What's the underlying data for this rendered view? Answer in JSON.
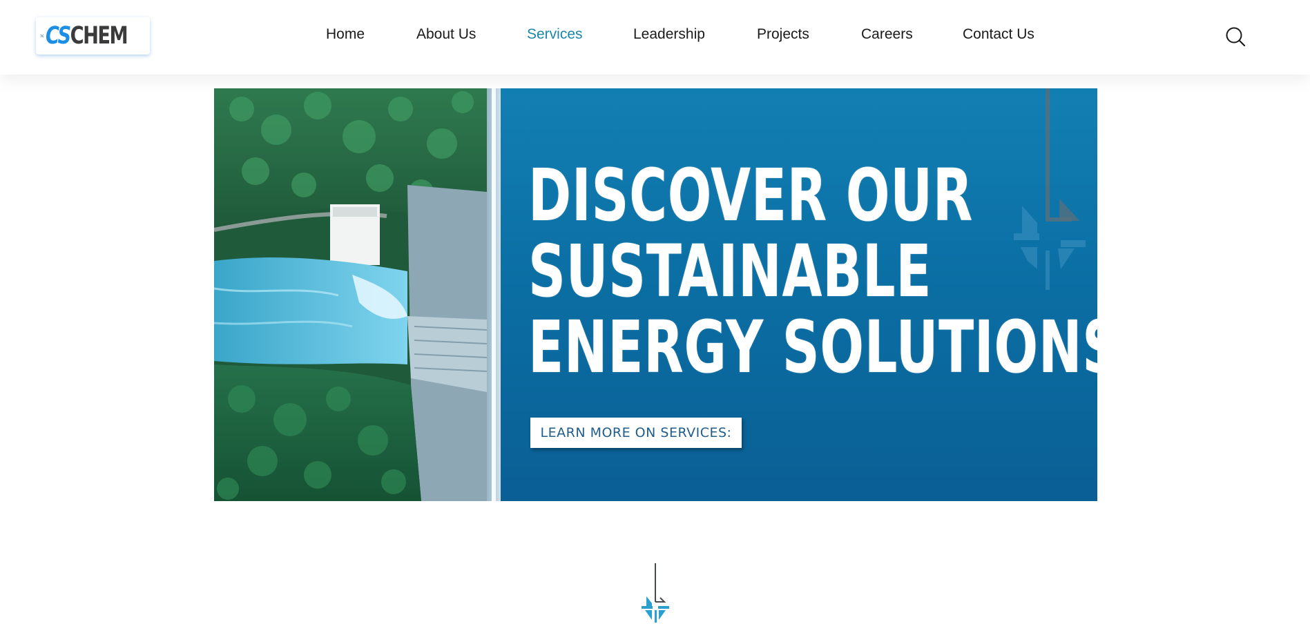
{
  "logo": {
    "cs_text": "CS",
    "chem_text": "CHEM",
    "brand_blue": "#1c8ee6",
    "brand_dark": "#3b3b3b"
  },
  "nav": {
    "items": [
      {
        "label": "Home",
        "active": false
      },
      {
        "label": "About Us",
        "active": false
      },
      {
        "label": "Services",
        "active": true
      },
      {
        "label": "Leadership",
        "active": false
      },
      {
        "label": "Projects",
        "active": false
      },
      {
        "label": "Careers",
        "active": false
      },
      {
        "label": "Contact Us",
        "active": false
      }
    ],
    "active_color": "#1a87aa",
    "search_icon": "search-icon"
  },
  "hero": {
    "headline_lines": [
      "DISCOVER OUR",
      "SUSTAINABLE",
      "ENERGY SOLUTIONS."
    ],
    "cta_label": "LEARN MORE ON SERVICES:",
    "background_color": "#0d6a9e",
    "photo": "aerial-hydroelectric-dam-image",
    "emblem": "cschem-emblem-icon"
  },
  "divider": {
    "emblem": "cschem-emblem-icon",
    "emblem_color": "#2aa0d0"
  }
}
